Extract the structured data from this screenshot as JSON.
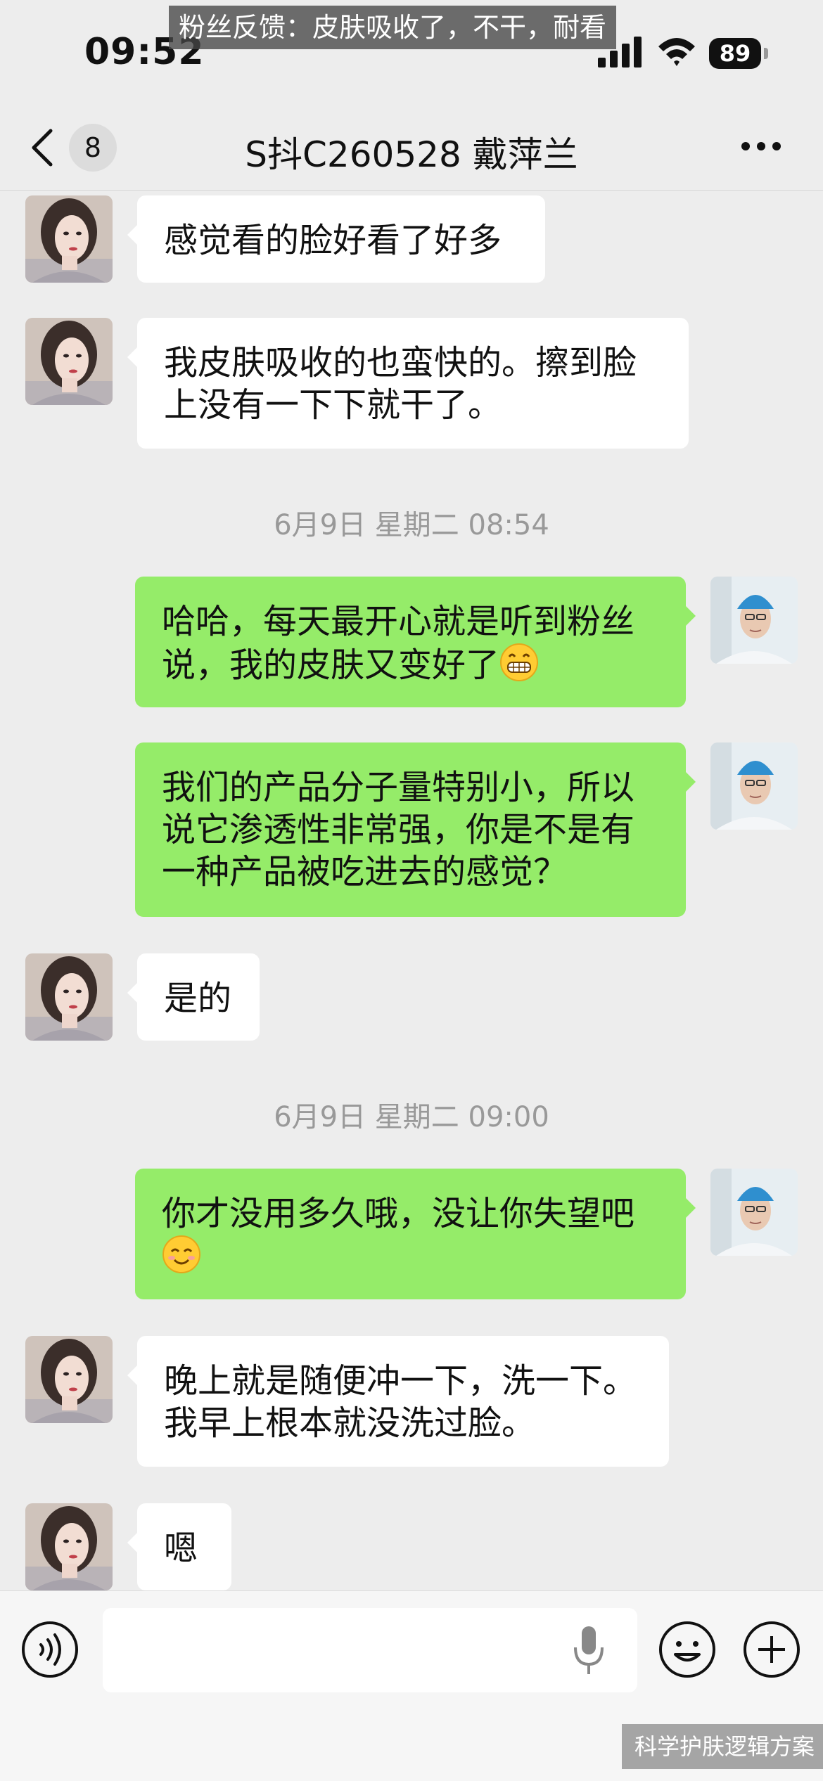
{
  "status_bar": {
    "time": "09:52",
    "battery": "89"
  },
  "caption": "粉丝反馈：皮肤吸收了，不干，耐看",
  "nav": {
    "unread_count": "8",
    "title": "S抖C260528 戴萍兰"
  },
  "messages": [
    {
      "side": "in",
      "text": "感觉看的脸好看了好多"
    },
    {
      "side": "in",
      "line1": "我皮肤吸收的也蛮快的。擦到脸",
      "line2": "上没有一下下就干了。"
    },
    {
      "timestamp": "6月9日 星期二 08:54"
    },
    {
      "side": "out",
      "line1": "哈哈，每天最开心就是听到粉丝",
      "line2": "说，我的皮肤又变好了",
      "emoji": "grin-emoji"
    },
    {
      "side": "out",
      "line1": "我们的产品分子量特别小，所以",
      "line2": "说它渗透性非常强，你是不是有",
      "line3": "一种产品被吃进去的感觉？"
    },
    {
      "side": "in",
      "text": "是的"
    },
    {
      "timestamp": "6月9日 星期二 09:00"
    },
    {
      "side": "out",
      "line1": "你才没用多久哦，没让你失望吧",
      "emoji": "smile-emoji"
    },
    {
      "side": "in",
      "line1": "晚上就是随便冲一下，洗一下。",
      "line2": "我早上根本就没洗过脸。"
    },
    {
      "side": "in",
      "text": "嗯"
    }
  ],
  "watermark": "科学护肤逻辑方案",
  "colors": {
    "background": "#ededed",
    "out_bubble": "#95ec69",
    "in_bubble": "#ffffff"
  }
}
